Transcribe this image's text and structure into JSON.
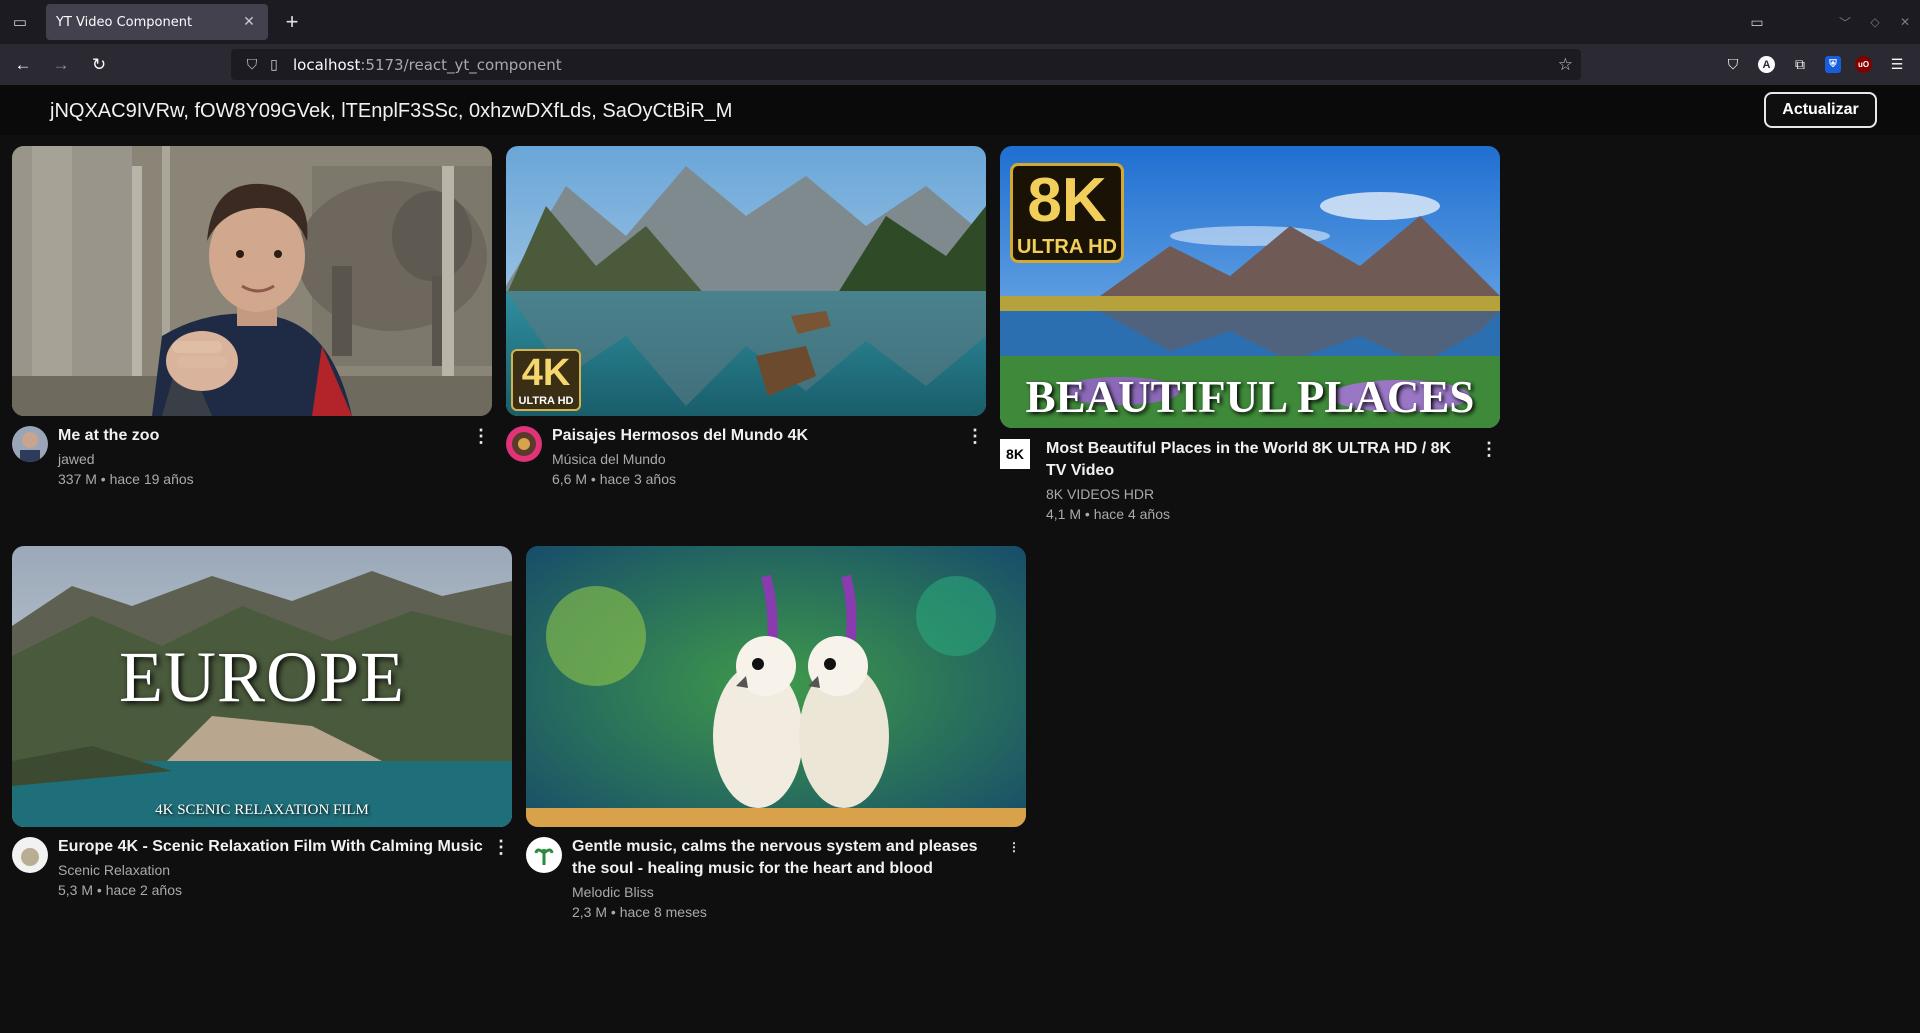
{
  "browser": {
    "tab_title": "YT Video Component",
    "url_host": "localhost",
    "url_path": ":5173/react_yt_component"
  },
  "header": {
    "video_ids": "jNQXAC9IVRw, fOW8Y09GVek, lTEnplF3SSc, 0xhzwDXfLds, SaOyCtBiR_M",
    "refresh_label": "Actualizar"
  },
  "videos": [
    {
      "title": "Me at the zoo",
      "channel": "jawed",
      "stats": "337 M • hace 19 años"
    },
    {
      "title": "Paisajes Hermosos del Mundo 4K",
      "channel": "Música del Mundo",
      "stats": "6,6 M • hace 3 años",
      "badge_main": "4K",
      "badge_sub": "ULTRA HD"
    },
    {
      "title": "Most Beautiful Places in the World 8K ULTRA HD / 8K TV Video",
      "channel": "8K VIDEOS HDR",
      "stats": "4,1 M • hace 4 años",
      "badge_main": "8K",
      "badge_sub": "ULTRA HD",
      "overlay": "BEAUTIFUL PLACES",
      "avatar_text": "8K"
    },
    {
      "title": "Europe 4K - Scenic Relaxation Film With Calming Music",
      "channel": "Scenic Relaxation",
      "stats": "5,3 M • hace 2 años",
      "overlay": "EUROPE",
      "overlay_sub": "4K SCENIC RELAXATION FILM"
    },
    {
      "title": "Gentle music, calms the nervous system and pleases the soul - healing music for the heart and blood",
      "channel": "Melodic Bliss",
      "stats": "2,3 M • hace 8 meses"
    }
  ]
}
